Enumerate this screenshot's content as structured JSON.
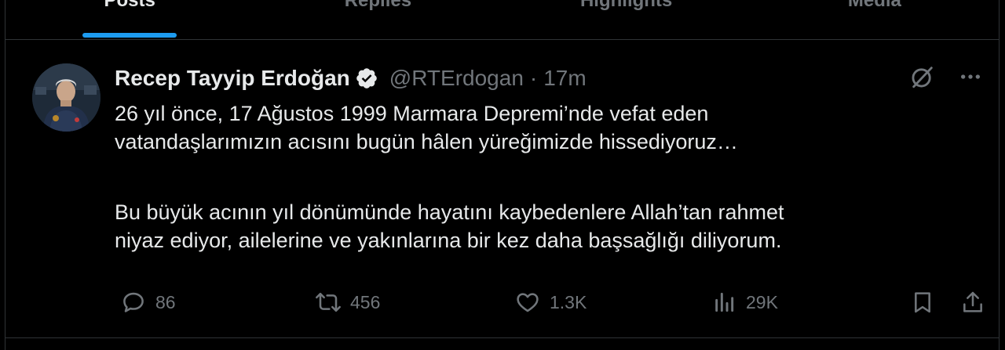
{
  "tabs": [
    {
      "label": "Posts",
      "active": true
    },
    {
      "label": "Replies",
      "active": false
    },
    {
      "label": "Highlights",
      "active": false
    },
    {
      "label": "Media",
      "active": false
    }
  ],
  "tweet": {
    "author_name": "Recep Tayyip Erdoğan",
    "handle": "@RTErdogan",
    "separator": "·",
    "time": "17m",
    "paragraphs": [
      [
        "26 yıl önce, 17 Ağustos 1999 Marmara Depremi’nde vefat eden",
        "vatandaşlarımızın acısını bugün hâlen yüreğimizde hissediyoruz…"
      ],
      [
        "Bu büyük acının yıl dönümünde hayatını kaybedenlere Allah’tan rahmet",
        "niyaz ediyor, ailelerine ve yakınlarına bir kez daha başsağlığı diliyorum."
      ]
    ],
    "actions": {
      "reply_count": "86",
      "repost_count": "456",
      "like_count": "1.3K",
      "view_count": "29K"
    },
    "icons": {
      "verified": "verified-badge-icon",
      "grok": "grok-icon",
      "more": "more-icon",
      "reply": "reply-icon",
      "repost": "repost-icon",
      "like": "heart-icon",
      "views": "views-icon",
      "bookmark": "bookmark-icon",
      "share": "share-icon"
    }
  },
  "colors": {
    "background": "#000000",
    "text": "#e7e9ea",
    "muted": "#71767b",
    "accent": "#1d9bf0",
    "border": "#2f3336"
  }
}
